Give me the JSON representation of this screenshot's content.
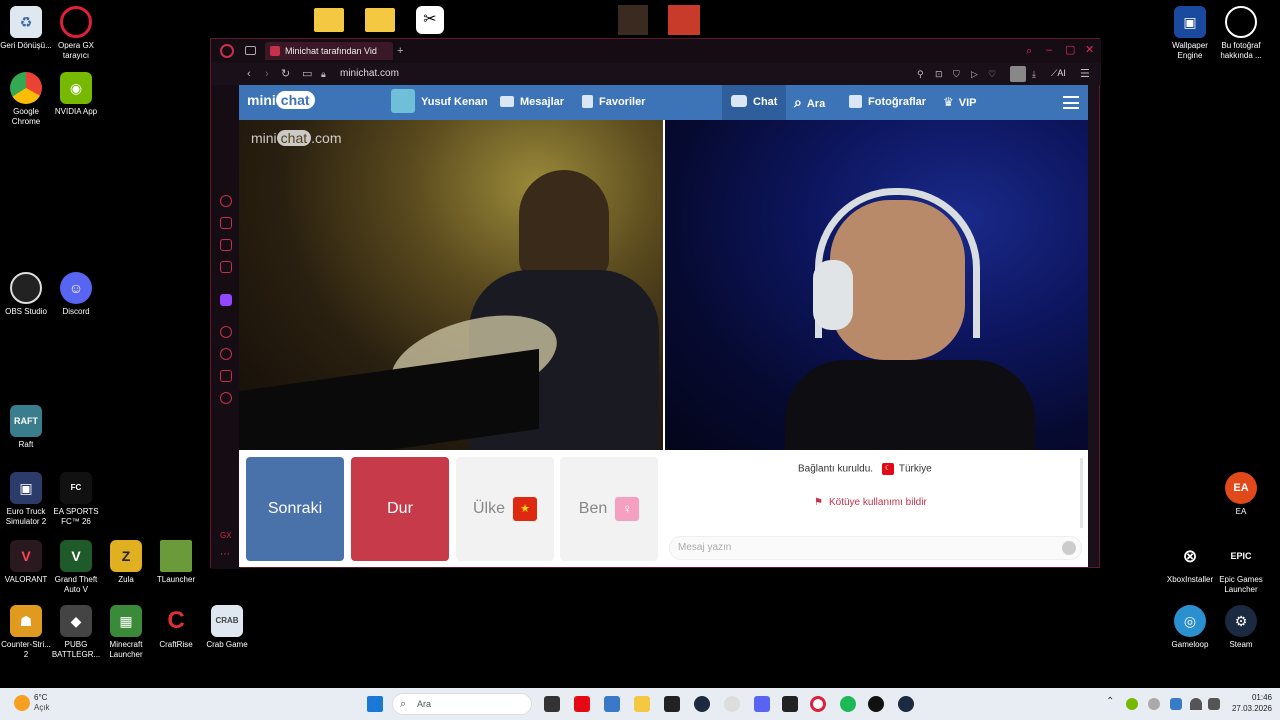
{
  "desktop": {
    "left_icons": [
      {
        "name": "recycle-bin",
        "label": "Geri Dönüşü..."
      },
      {
        "name": "opera-gx",
        "label": "Opera GX tarayıcı"
      },
      {
        "name": "google-chrome",
        "label": "Google Chrome"
      },
      {
        "name": "nvidia-app",
        "label": "NVIDIA App"
      },
      {
        "name": "obs-studio",
        "label": "OBS Studio"
      },
      {
        "name": "discord",
        "label": "Discord"
      },
      {
        "name": "raft",
        "label": "Raft"
      },
      {
        "name": "euro-truck",
        "label": "Euro Truck Simulator 2"
      },
      {
        "name": "ea-sports-fc",
        "label": "EA SPORTS FC™ 26"
      },
      {
        "name": "valorant",
        "label": "VALORANT"
      },
      {
        "name": "gta-v",
        "label": "Grand Theft Auto V"
      },
      {
        "name": "zula",
        "label": "Zula"
      },
      {
        "name": "tlauncher",
        "label": "TLauncher"
      },
      {
        "name": "counter-strike",
        "label": "Counter-Stri... 2"
      },
      {
        "name": "pubg",
        "label": "PUBG BATTLEGR..."
      },
      {
        "name": "minecraft-launcher",
        "label": "Minecraft Launcher"
      },
      {
        "name": "craftrise",
        "label": "CraftRise"
      },
      {
        "name": "crab-game",
        "label": "Crab Game"
      }
    ],
    "right_icons": [
      {
        "name": "wallpaper-engine",
        "label": "Wallpaper Engine"
      },
      {
        "name": "bu-fotograf",
        "label": "Bu fotoğraf hakkında ..."
      },
      {
        "name": "ea",
        "label": "EA"
      },
      {
        "name": "xbox-installer",
        "label": "XboxInstaller"
      },
      {
        "name": "epic-games",
        "label": "Epic Games Launcher"
      },
      {
        "name": "gameloop",
        "label": "Gameloop"
      },
      {
        "name": "steam",
        "label": "Steam"
      }
    ]
  },
  "browser": {
    "tab_title": "Minichat tarafından Vid",
    "url": "minichat.com",
    "ai_label": "AI"
  },
  "minichat": {
    "logo_left": "mini",
    "logo_bubble": "chat",
    "nav": {
      "user": "Yusuf Kenan",
      "messages": "Mesajlar",
      "favorites": "Favoriler",
      "chat": "Chat",
      "search": "Ara",
      "photos": "Fotoğraflar",
      "vip": "VIP"
    },
    "watermark_left": "mini",
    "watermark_bubble": "chat",
    "watermark_right": ".com",
    "buttons": {
      "next": "Sonraki",
      "stop": "Dur",
      "country": "Ülke",
      "me": "Ben"
    },
    "status": "Bağlantı kuruldu.",
    "country_name": "Türkiye",
    "report": "Kötüye kullanımı bildir",
    "message_placeholder": "Mesaj yazın"
  },
  "taskbar": {
    "weather_temp": "6°C",
    "weather_desc": "Açık",
    "search_placeholder": "Ara",
    "time": "01:46",
    "date": "27.03.2026"
  },
  "colors": {
    "nav_blue": "#3d74b7",
    "next_button": "#4a72aa",
    "stop_button": "#c73a4a",
    "opera_red": "#c8304a"
  }
}
